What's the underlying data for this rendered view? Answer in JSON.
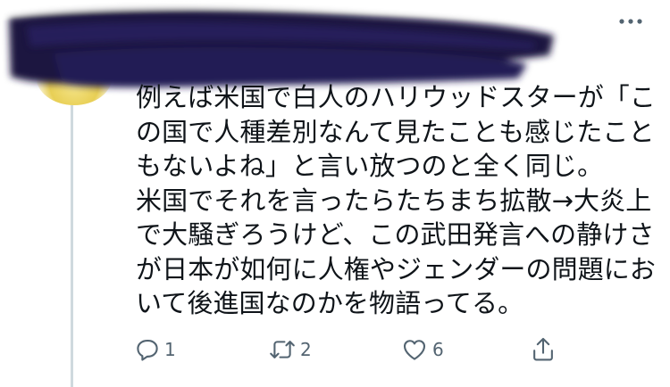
{
  "tweet": {
    "lines": [
      "例えば米国で白人のハリウッドスターが「こ",
      "の国で人種差別なんて見たことも感じたこと",
      "もないよね」と言い放つのと全く同じ。",
      "米国でそれを言ったらたちまち拡散→大炎上",
      "で大騒ぎろうけど、この武田発言への静けさ",
      "が日本が如何に人権やジェンダーの問題にお",
      "いて後進国なのかを物語ってる。"
    ]
  },
  "actions": {
    "reply": {
      "icon": "reply-icon",
      "count": "1"
    },
    "retweet": {
      "icon": "retweet-icon",
      "count": "2"
    },
    "like": {
      "icon": "heart-icon",
      "count": "6"
    },
    "share": {
      "icon": "share-icon"
    }
  },
  "colors": {
    "text": "#0f1419",
    "secondary": "#536471",
    "redaction": "#1a1440",
    "thread_line": "#cfd9de"
  }
}
